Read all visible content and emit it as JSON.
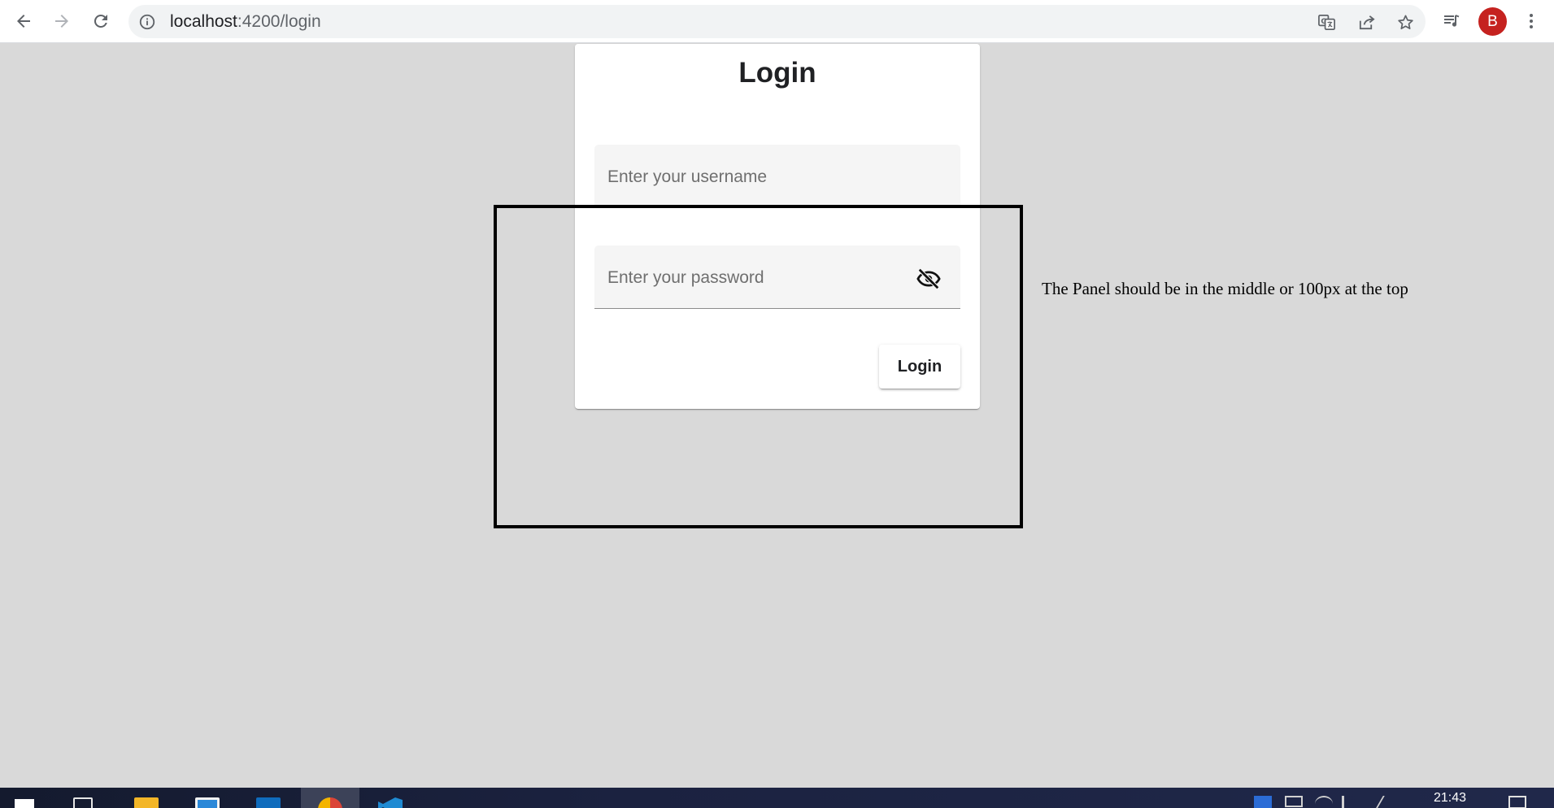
{
  "browser": {
    "url_host": "localhost",
    "url_path": ":4200/login",
    "profile_initial": "B",
    "icons": {
      "back": "arrow-left-icon",
      "forward": "arrow-right-icon",
      "reload": "reload-icon",
      "site_info": "info-icon",
      "translate": "translate-icon",
      "share": "share-icon",
      "bookmark": "star-icon",
      "media": "media-queue-icon",
      "menu": "kebab-menu-icon"
    },
    "forward_disabled": true
  },
  "login_card": {
    "title": "Login",
    "username_placeholder": "Enter your username",
    "password_placeholder": "Enter your password",
    "password_toggle_icon": "eye-off-icon",
    "submit_label": "Login"
  },
  "annotation": {
    "note": "The Panel should be in the middle or 100px  at the top"
  },
  "taskbar": {
    "time": "21:43",
    "apps": [
      "start",
      "task-view",
      "file-explorer",
      "store",
      "mail",
      "chrome",
      "vscode"
    ],
    "active_app": "chrome"
  },
  "colors": {
    "page_background": "#d9d9d9",
    "card_background": "#ffffff",
    "field_background": "#f5f5f5",
    "avatar": "#c5221f",
    "taskbar": "#1b2240"
  }
}
